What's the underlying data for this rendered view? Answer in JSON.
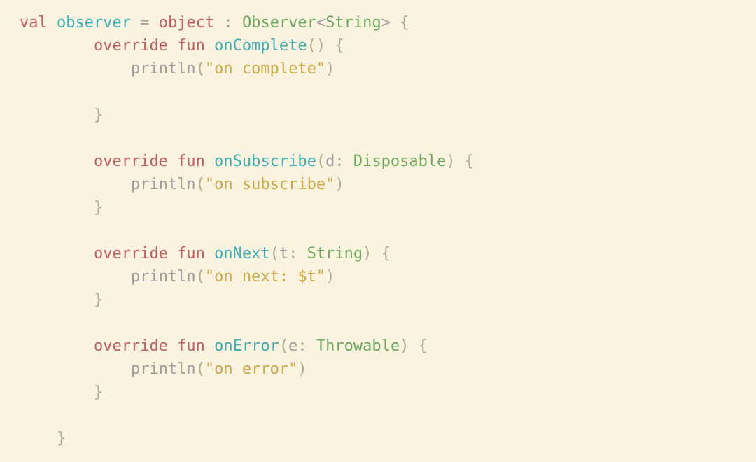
{
  "code": {
    "kw_val": "val",
    "var_observer": "observer",
    "op_eq": " = ",
    "kw_object": "object",
    "op_colon_sp": " : ",
    "type_observer": "Observer",
    "lt": "<",
    "gt": ">",
    "type_string": "String",
    "lbrace": " {",
    "rbrace": "}",
    "lparen": "(",
    "rparen": ")",
    "kw_override": "override",
    "kw_fun": " fun ",
    "fn_onComplete": "onComplete",
    "fn_onSubscribe": "onSubscribe",
    "fn_onNext": "onNext",
    "fn_onError": "onError",
    "param_d": "d",
    "param_t": "t",
    "param_e": "e",
    "colon_sp": ": ",
    "type_disposable": "Disposable",
    "type_throwable": "Throwable",
    "call_println": "println",
    "str_complete": "\"on complete\"",
    "str_subscribe": "\"on subscribe\"",
    "str_next": "\"on next: $t\"",
    "str_error": "\"on error\""
  }
}
